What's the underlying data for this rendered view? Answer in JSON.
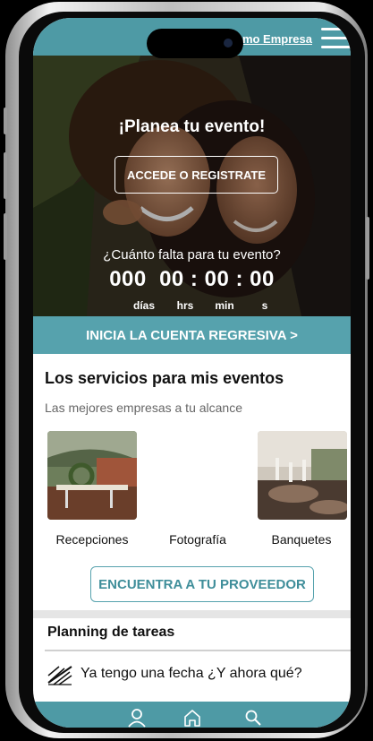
{
  "header": {
    "empresa_link": "omo Empresa",
    "menu_icon": "hamburger-menu-icon"
  },
  "hero": {
    "title": "¡Planea tu evento!",
    "access_button": "ACCEDE O REGISTRATE",
    "countdown_question": "¿Cuánto falta para tu evento?",
    "countdown_value": "000  00 : 00 : 00",
    "units": [
      "días",
      "hrs",
      "min",
      "s"
    ]
  },
  "countdown_cta": "INICIA LA CUENTA REGRESIVA >",
  "services": {
    "title": "Los servicios para mis eventos",
    "subtitle": "Las mejores empresas a tu alcance",
    "items": [
      {
        "label": "Recepciones"
      },
      {
        "label": "Fotografía"
      },
      {
        "label": "Banquetes"
      }
    ],
    "provider_button": "ENCUENTRA A TU PROVEEDOR"
  },
  "planning": {
    "title": "Planning de tareas",
    "task": "Ya tengo una fecha ¿Y ahora qué?",
    "task_icon": "signature-icon"
  },
  "bottom_nav": {
    "icons": [
      "user-icon",
      "home-icon",
      "search-icon"
    ]
  },
  "colors": {
    "accent": "#4e9aa5",
    "accent_band": "#56a2ad",
    "text": "#111111"
  }
}
